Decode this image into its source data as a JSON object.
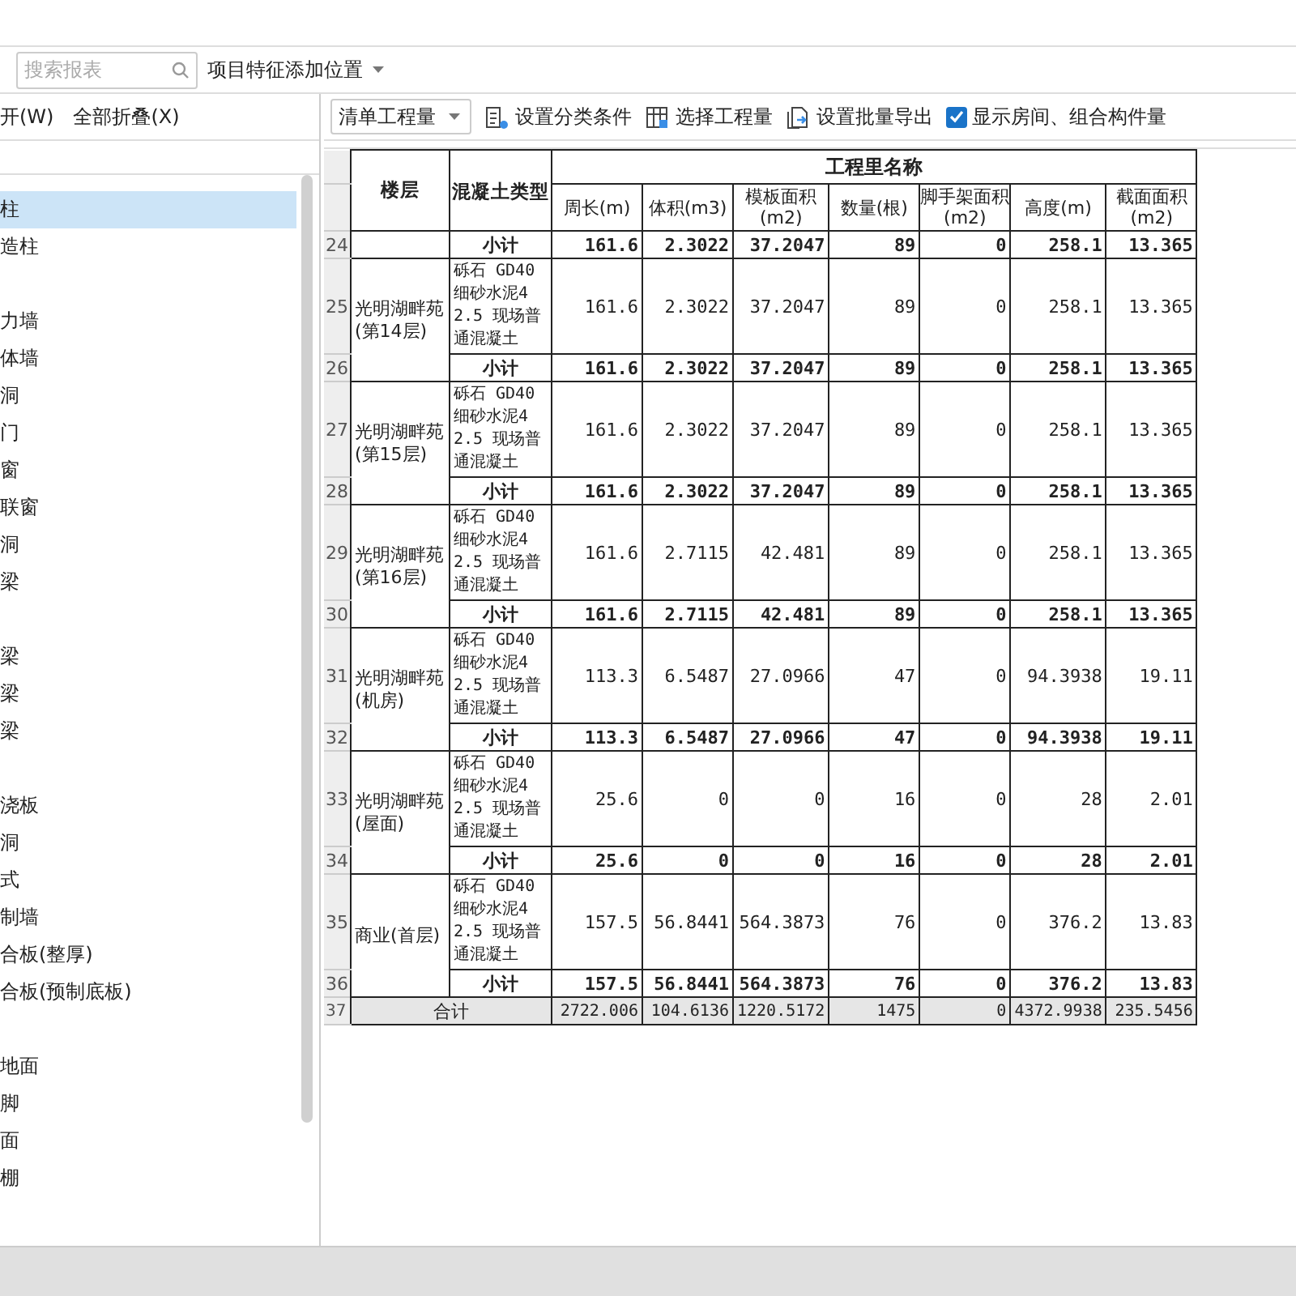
{
  "search": {
    "placeholder": "搜索报表"
  },
  "feature_position": {
    "label": "项目特征添加位置"
  },
  "tree_toolbar": {
    "items": [
      "开(W)",
      "全部折叠(X)"
    ]
  },
  "tree": {
    "groups": [
      {
        "items": [
          {
            "label": "柱",
            "selected": true
          },
          {
            "label": "造柱",
            "selected": false
          }
        ]
      },
      {
        "items": [
          {
            "label": "力墙",
            "selected": false
          },
          {
            "label": "体墙",
            "selected": false
          },
          {
            "label": "洞",
            "selected": false
          },
          {
            "label": "门",
            "selected": false
          },
          {
            "label": "窗",
            "selected": false
          },
          {
            "label": "联窗",
            "selected": false
          },
          {
            "label": "洞",
            "selected": false
          },
          {
            "label": "梁",
            "selected": false
          }
        ]
      },
      {
        "items": [
          {
            "label": "梁",
            "selected": false
          },
          {
            "label": "梁",
            "selected": false
          },
          {
            "label": "梁",
            "selected": false
          }
        ]
      },
      {
        "items": [
          {
            "label": "浇板",
            "selected": false
          },
          {
            "label": "洞",
            "selected": false
          },
          {
            "label": "式",
            "selected": false
          },
          {
            "label": "制墙",
            "selected": false
          },
          {
            "label": "合板(整厚)",
            "selected": false
          },
          {
            "label": "合板(预制底板)",
            "selected": false
          }
        ]
      },
      {
        "items": [
          {
            "label": "地面",
            "selected": false
          },
          {
            "label": "脚",
            "selected": false
          },
          {
            "label": "面",
            "selected": false
          },
          {
            "label": "棚",
            "selected": false
          }
        ]
      }
    ]
  },
  "report_toolbar": {
    "mode": "清单工程量",
    "actions": [
      {
        "kind": "filter",
        "label": "设置分类条件"
      },
      {
        "kind": "grid",
        "label": "选择工程量"
      },
      {
        "kind": "export",
        "label": "设置批量导出"
      }
    ],
    "checkbox": {
      "label": "显示房间、组合构件量",
      "checked": true
    }
  },
  "table": {
    "floor_header": "楼层",
    "type_header": "混凝土类型",
    "group_header": "工程里名称",
    "columns": [
      "周长(m)",
      "体积(m3)",
      "模板面积(m2)",
      "数量(根)",
      "脚手架面积(m2)",
      "高度(m)",
      "截面面积(m2)"
    ],
    "rows": [
      {
        "number": "24",
        "kind": "subtotal",
        "label": "小计",
        "values": [
          "161.6",
          "2.3022",
          "37.2047",
          "89",
          "0",
          "258.1",
          "13.365"
        ]
      },
      {
        "number": "25",
        "kind": "detail",
        "floor": "光明湖畔苑(第14层)",
        "type": "砾石 GD40细砂水泥42.5 现场普通混凝土",
        "values": [
          "161.6",
          "2.3022",
          "37.2047",
          "89",
          "0",
          "258.1",
          "13.365"
        ]
      },
      {
        "number": "26",
        "kind": "subtotal",
        "label": "小计",
        "values": [
          "161.6",
          "2.3022",
          "37.2047",
          "89",
          "0",
          "258.1",
          "13.365"
        ]
      },
      {
        "number": "27",
        "kind": "detail",
        "floor": "光明湖畔苑(第15层)",
        "type": "砾石 GD40细砂水泥42.5 现场普通混凝土",
        "values": [
          "161.6",
          "2.3022",
          "37.2047",
          "89",
          "0",
          "258.1",
          "13.365"
        ]
      },
      {
        "number": "28",
        "kind": "subtotal",
        "label": "小计",
        "values": [
          "161.6",
          "2.3022",
          "37.2047",
          "89",
          "0",
          "258.1",
          "13.365"
        ]
      },
      {
        "number": "29",
        "kind": "detail",
        "floor": "光明湖畔苑(第16层)",
        "type": "砾石 GD40细砂水泥42.5 现场普通混凝土",
        "values": [
          "161.6",
          "2.7115",
          "42.481",
          "89",
          "0",
          "258.1",
          "13.365"
        ]
      },
      {
        "number": "30",
        "kind": "subtotal",
        "label": "小计",
        "values": [
          "161.6",
          "2.7115",
          "42.481",
          "89",
          "0",
          "258.1",
          "13.365"
        ]
      },
      {
        "number": "31",
        "kind": "detail",
        "floor": "光明湖畔苑(机房)",
        "type": "砾石 GD40细砂水泥42.5 现场普通混凝土",
        "values": [
          "113.3",
          "6.5487",
          "27.0966",
          "47",
          "0",
          "94.3938",
          "19.11"
        ]
      },
      {
        "number": "32",
        "kind": "subtotal",
        "label": "小计",
        "values": [
          "113.3",
          "6.5487",
          "27.0966",
          "47",
          "0",
          "94.3938",
          "19.11"
        ]
      },
      {
        "number": "33",
        "kind": "detail",
        "floor": "光明湖畔苑(屋面)",
        "type": "砾石 GD40细砂水泥42.5 现场普通混凝土",
        "values": [
          "25.6",
          "0",
          "0",
          "16",
          "0",
          "28",
          "2.01"
        ]
      },
      {
        "number": "34",
        "kind": "subtotal",
        "label": "小计",
        "values": [
          "25.6",
          "0",
          "0",
          "16",
          "0",
          "28",
          "2.01"
        ]
      },
      {
        "number": "35",
        "kind": "detail",
        "floor": "商业(首层)",
        "type": "砾石 GD40细砂水泥42.5 现场普通混凝土",
        "values": [
          "157.5",
          "56.8441",
          "564.3873",
          "76",
          "0",
          "376.2",
          "13.83"
        ]
      },
      {
        "number": "36",
        "kind": "subtotal",
        "label": "小计",
        "values": [
          "157.5",
          "56.8441",
          "564.3873",
          "76",
          "0",
          "376.2",
          "13.83"
        ]
      },
      {
        "number": "37",
        "kind": "total",
        "title": "合计",
        "values": [
          "2722.006",
          "104.6136",
          "1220.5172",
          "1475",
          "0",
          "4372.9938",
          "235.5456"
        ]
      }
    ]
  }
}
